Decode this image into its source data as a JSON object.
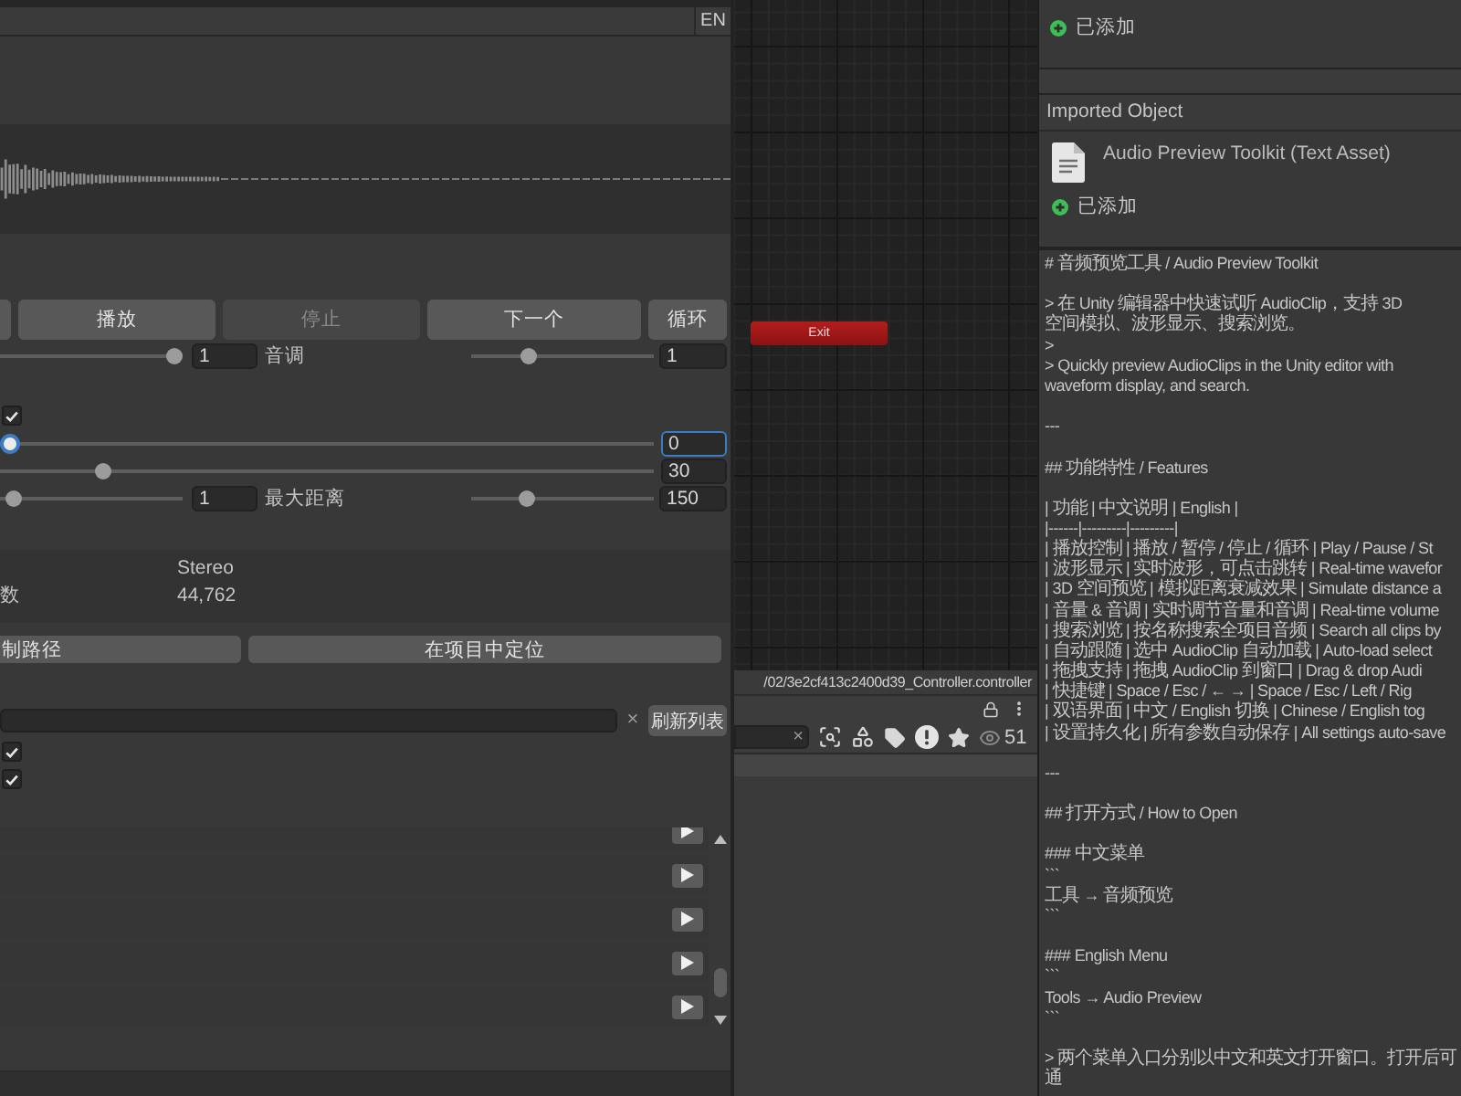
{
  "lang_bar": {
    "button": "EN"
  },
  "transport": [
    {
      "label": "播放",
      "disabled": false
    },
    {
      "label": "停止",
      "disabled": true
    },
    {
      "label": "下一个",
      "disabled": false
    },
    {
      "label": "循环",
      "disabled": false
    }
  ],
  "controls": [
    {
      "kind": "pair",
      "left": {
        "level": 1,
        "value": "1"
      },
      "label": "音调",
      "right": {
        "level": 0.3,
        "value": "1"
      }
    },
    {
      "kind": "checkbox",
      "checked": true
    },
    {
      "kind": "slider",
      "level": 0,
      "value": "0",
      "focused": true
    },
    {
      "kind": "slider",
      "level": 0.15,
      "value": "30",
      "focused": false
    },
    {
      "kind": "pair",
      "left": {
        "level": 0.03,
        "value": "1"
      },
      "label": "最大距离",
      "right": {
        "level": 0.29,
        "value": "150"
      }
    }
  ],
  "info": [
    {
      "value": "Stereo"
    },
    {
      "label": "数",
      "value": "44,762"
    }
  ],
  "actions": [
    "制路径",
    "在项目中定位"
  ],
  "search": {
    "clear": "×",
    "button": "刷新列表"
  },
  "filters": [
    {
      "checked": true
    },
    {
      "checked": true
    }
  ],
  "graph": {
    "nodes": [
      {
        "label": "Exit"
      }
    ]
  },
  "project": {
    "path": "/02/3e2cf413c2400d39_Controller.controller",
    "search_clear": "×",
    "count": "51"
  },
  "inspector": {
    "status": "已添加",
    "section": "Imported Object",
    "asset": {
      "name": "Audio Preview Toolkit (Text Asset)",
      "status": "已添加"
    },
    "text": [
      [
        "# 音频预览工具 / Audio Preview Toolkit"
      ],
      [
        "> 在 Unity 编辑器中快速试听 AudioClip，支持 3D",
        "空间模拟、波形显示、搜索浏览。",
        ">",
        "> Quickly preview AudioClips in the Unity editor with",
        "waveform display, and search."
      ],
      [
        "---"
      ],
      [
        "## 功能特性 / Features"
      ],
      [
        "| 功能 | 中文说明 | English |",
        "|------|---------|---------|",
        "| 播放控制 | 播放 / 暂停 / 停止 / 循环 | Play / Pause / St",
        "| 波形显示 | 实时波形，可点击跳转 | Real-time wavefor",
        "| 3D 空间预览 | 模拟距离衰减效果 | Simulate distance a",
        "| 音量 & 音调 | 实时调节音量和音调 | Real-time volume",
        "| 搜索浏览 | 按名称搜索全项目音频 | Search all clips by",
        "| 自动跟随 | 选中 AudioClip 自动加载 | Auto-load select",
        "| 拖拽支持 | 拖拽 AudioClip 到窗口 | Drag & drop Audi",
        "| 快捷键 | Space / Esc / ← → | Space / Esc / Left / Rig",
        "| 双语界面 | 中文 / English 切换 | Chinese / English tog",
        "| 设置持久化 | 所有参数自动保存 | All settings auto-save"
      ],
      [
        "---"
      ],
      [
        "## 打开方式 / How to Open"
      ],
      [
        "### 中文菜单",
        "```",
        "工具 → 音频预览",
        "```"
      ],
      [
        "### English Menu",
        "```",
        "Tools → Audio Preview",
        "```"
      ],
      [
        "> 两个菜单入口分别以中文和英文打开窗口。打开后可通"
      ]
    ]
  }
}
